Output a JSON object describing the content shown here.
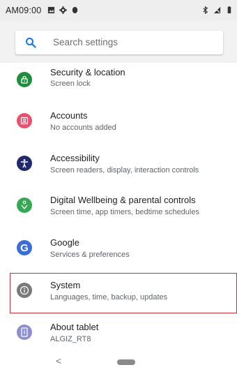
{
  "status_bar": {
    "time": "AM09:00",
    "left_icons": [
      "image-icon",
      "gear-icon",
      "shield-icon"
    ],
    "right_icons": [
      "bluetooth-icon",
      "no-signal-icon",
      "battery-icon"
    ]
  },
  "search": {
    "placeholder": "Search settings"
  },
  "settings": [
    {
      "title": "Security & location",
      "subtitle": "Screen lock",
      "icon": "lock-icon",
      "color": "#1e8e3e"
    },
    {
      "title": "Accounts",
      "subtitle": "No accounts added",
      "icon": "account-icon",
      "color": "#e8506f"
    },
    {
      "title": "Accessibility",
      "subtitle": "Screen readers, display, interaction controls",
      "icon": "accessibility-icon",
      "color": "#202a6c"
    },
    {
      "title": "Digital Wellbeing & parental controls",
      "subtitle": "Screen time, app timers, bedtime schedules",
      "icon": "wellbeing-icon",
      "color": "#34a853"
    },
    {
      "title": "Google",
      "subtitle": "Services & preferences",
      "icon": "google-icon",
      "color": "#3b6ed6"
    },
    {
      "title": "System",
      "subtitle": "Languages, time, backup, updates",
      "icon": "info-icon",
      "color": "#7a7a7a"
    },
    {
      "title": "About tablet",
      "subtitle": "ALGIZ_RT8",
      "icon": "tablet-icon",
      "color": "#8e8fcf"
    }
  ],
  "nav": {
    "back": "<"
  },
  "colors": {
    "highlight": "#cf2f3a",
    "search_bg": "#f2f2f2"
  }
}
